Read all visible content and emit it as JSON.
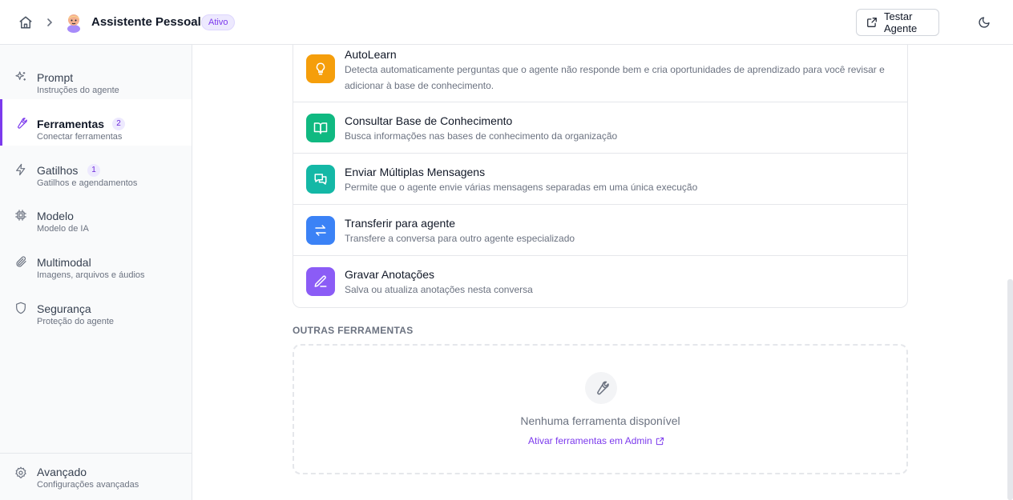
{
  "header": {
    "agent_name": "Assistente Pessoal",
    "status": "Ativo",
    "test_button": "Testar Agente"
  },
  "sidebar": {
    "items": [
      {
        "title": "Prompt",
        "subtitle": "Instruções do agente",
        "icon": "sparkles-icon"
      },
      {
        "title": "Ferramentas",
        "subtitle": "Conectar ferramentas",
        "count": "2",
        "icon": "wrench-icon",
        "active": true
      },
      {
        "title": "Gatilhos",
        "subtitle": "Gatilhos e agendamentos",
        "count": "1",
        "icon": "lightning-icon"
      },
      {
        "title": "Modelo",
        "subtitle": "Modelo de IA",
        "icon": "chip-icon"
      },
      {
        "title": "Multimodal",
        "subtitle": "Imagens, arquivos e áudios",
        "icon": "paperclip-icon"
      },
      {
        "title": "Segurança",
        "subtitle": "Proteção do agente",
        "icon": "shield-icon"
      }
    ],
    "advanced": {
      "title": "Avançado",
      "subtitle": "Configurações avançadas",
      "icon": "gear-icon"
    }
  },
  "tools": [
    {
      "name": "AutoLearn",
      "description": "Detecta automaticamente perguntas que o agente não responde bem e cria oportunidades de aprendizado para você revisar e adicionar à base de conhecimento.",
      "color": "#f59e0b",
      "icon": "lightbulb-icon"
    },
    {
      "name": "Consultar Base de Conhecimento",
      "description": "Busca informações nas bases de conhecimento da organização",
      "color": "#10b981",
      "icon": "book-icon"
    },
    {
      "name": "Enviar Múltiplas Mensagens",
      "description": "Permite que o agente envie várias mensagens separadas em uma única execução",
      "color": "#14b8a6",
      "icon": "messages-icon"
    },
    {
      "name": "Transferir para agente",
      "description": "Transfere a conversa para outro agente especializado",
      "color": "#3b82f6",
      "icon": "arrows-exchange-icon"
    },
    {
      "name": "Gravar Anotações",
      "description": "Salva ou atualiza anotações nesta conversa",
      "color": "#8b5cf6",
      "icon": "pen-icon"
    }
  ],
  "other_tools": {
    "label": "OUTRAS FERRAMENTAS",
    "empty_text": "Nenhuma ferramenta disponível",
    "admin_link": "Ativar ferramentas em Admin"
  }
}
